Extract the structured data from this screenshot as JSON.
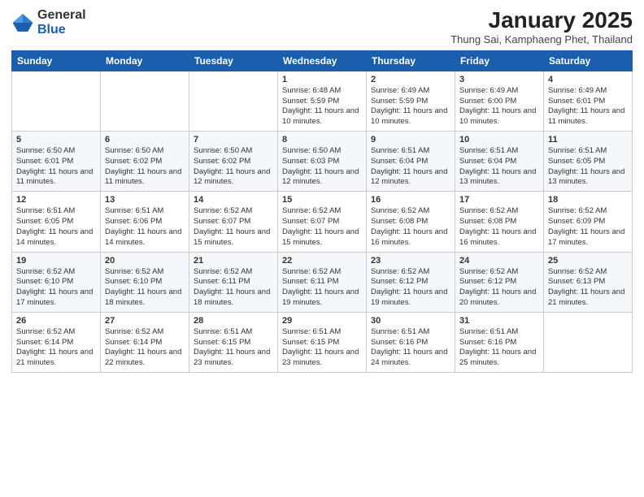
{
  "header": {
    "logo_general": "General",
    "logo_blue": "Blue",
    "month_year": "January 2025",
    "location": "Thung Sai, Kamphaeng Phet, Thailand"
  },
  "weekdays": [
    "Sunday",
    "Monday",
    "Tuesday",
    "Wednesday",
    "Thursday",
    "Friday",
    "Saturday"
  ],
  "weeks": [
    [
      {
        "day": "",
        "info": ""
      },
      {
        "day": "",
        "info": ""
      },
      {
        "day": "",
        "info": ""
      },
      {
        "day": "1",
        "info": "Sunrise: 6:48 AM\nSunset: 5:59 PM\nDaylight: 11 hours and 10 minutes."
      },
      {
        "day": "2",
        "info": "Sunrise: 6:49 AM\nSunset: 5:59 PM\nDaylight: 11 hours and 10 minutes."
      },
      {
        "day": "3",
        "info": "Sunrise: 6:49 AM\nSunset: 6:00 PM\nDaylight: 11 hours and 10 minutes."
      },
      {
        "day": "4",
        "info": "Sunrise: 6:49 AM\nSunset: 6:01 PM\nDaylight: 11 hours and 11 minutes."
      }
    ],
    [
      {
        "day": "5",
        "info": "Sunrise: 6:50 AM\nSunset: 6:01 PM\nDaylight: 11 hours and 11 minutes."
      },
      {
        "day": "6",
        "info": "Sunrise: 6:50 AM\nSunset: 6:02 PM\nDaylight: 11 hours and 11 minutes."
      },
      {
        "day": "7",
        "info": "Sunrise: 6:50 AM\nSunset: 6:02 PM\nDaylight: 11 hours and 12 minutes."
      },
      {
        "day": "8",
        "info": "Sunrise: 6:50 AM\nSunset: 6:03 PM\nDaylight: 11 hours and 12 minutes."
      },
      {
        "day": "9",
        "info": "Sunrise: 6:51 AM\nSunset: 6:04 PM\nDaylight: 11 hours and 12 minutes."
      },
      {
        "day": "10",
        "info": "Sunrise: 6:51 AM\nSunset: 6:04 PM\nDaylight: 11 hours and 13 minutes."
      },
      {
        "day": "11",
        "info": "Sunrise: 6:51 AM\nSunset: 6:05 PM\nDaylight: 11 hours and 13 minutes."
      }
    ],
    [
      {
        "day": "12",
        "info": "Sunrise: 6:51 AM\nSunset: 6:05 PM\nDaylight: 11 hours and 14 minutes."
      },
      {
        "day": "13",
        "info": "Sunrise: 6:51 AM\nSunset: 6:06 PM\nDaylight: 11 hours and 14 minutes."
      },
      {
        "day": "14",
        "info": "Sunrise: 6:52 AM\nSunset: 6:07 PM\nDaylight: 11 hours and 15 minutes."
      },
      {
        "day": "15",
        "info": "Sunrise: 6:52 AM\nSunset: 6:07 PM\nDaylight: 11 hours and 15 minutes."
      },
      {
        "day": "16",
        "info": "Sunrise: 6:52 AM\nSunset: 6:08 PM\nDaylight: 11 hours and 16 minutes."
      },
      {
        "day": "17",
        "info": "Sunrise: 6:52 AM\nSunset: 6:08 PM\nDaylight: 11 hours and 16 minutes."
      },
      {
        "day": "18",
        "info": "Sunrise: 6:52 AM\nSunset: 6:09 PM\nDaylight: 11 hours and 17 minutes."
      }
    ],
    [
      {
        "day": "19",
        "info": "Sunrise: 6:52 AM\nSunset: 6:10 PM\nDaylight: 11 hours and 17 minutes."
      },
      {
        "day": "20",
        "info": "Sunrise: 6:52 AM\nSunset: 6:10 PM\nDaylight: 11 hours and 18 minutes."
      },
      {
        "day": "21",
        "info": "Sunrise: 6:52 AM\nSunset: 6:11 PM\nDaylight: 11 hours and 18 minutes."
      },
      {
        "day": "22",
        "info": "Sunrise: 6:52 AM\nSunset: 6:11 PM\nDaylight: 11 hours and 19 minutes."
      },
      {
        "day": "23",
        "info": "Sunrise: 6:52 AM\nSunset: 6:12 PM\nDaylight: 11 hours and 19 minutes."
      },
      {
        "day": "24",
        "info": "Sunrise: 6:52 AM\nSunset: 6:12 PM\nDaylight: 11 hours and 20 minutes."
      },
      {
        "day": "25",
        "info": "Sunrise: 6:52 AM\nSunset: 6:13 PM\nDaylight: 11 hours and 21 minutes."
      }
    ],
    [
      {
        "day": "26",
        "info": "Sunrise: 6:52 AM\nSunset: 6:14 PM\nDaylight: 11 hours and 21 minutes."
      },
      {
        "day": "27",
        "info": "Sunrise: 6:52 AM\nSunset: 6:14 PM\nDaylight: 11 hours and 22 minutes."
      },
      {
        "day": "28",
        "info": "Sunrise: 6:51 AM\nSunset: 6:15 PM\nDaylight: 11 hours and 23 minutes."
      },
      {
        "day": "29",
        "info": "Sunrise: 6:51 AM\nSunset: 6:15 PM\nDaylight: 11 hours and 23 minutes."
      },
      {
        "day": "30",
        "info": "Sunrise: 6:51 AM\nSunset: 6:16 PM\nDaylight: 11 hours and 24 minutes."
      },
      {
        "day": "31",
        "info": "Sunrise: 6:51 AM\nSunset: 6:16 PM\nDaylight: 11 hours and 25 minutes."
      },
      {
        "day": "",
        "info": ""
      }
    ]
  ]
}
